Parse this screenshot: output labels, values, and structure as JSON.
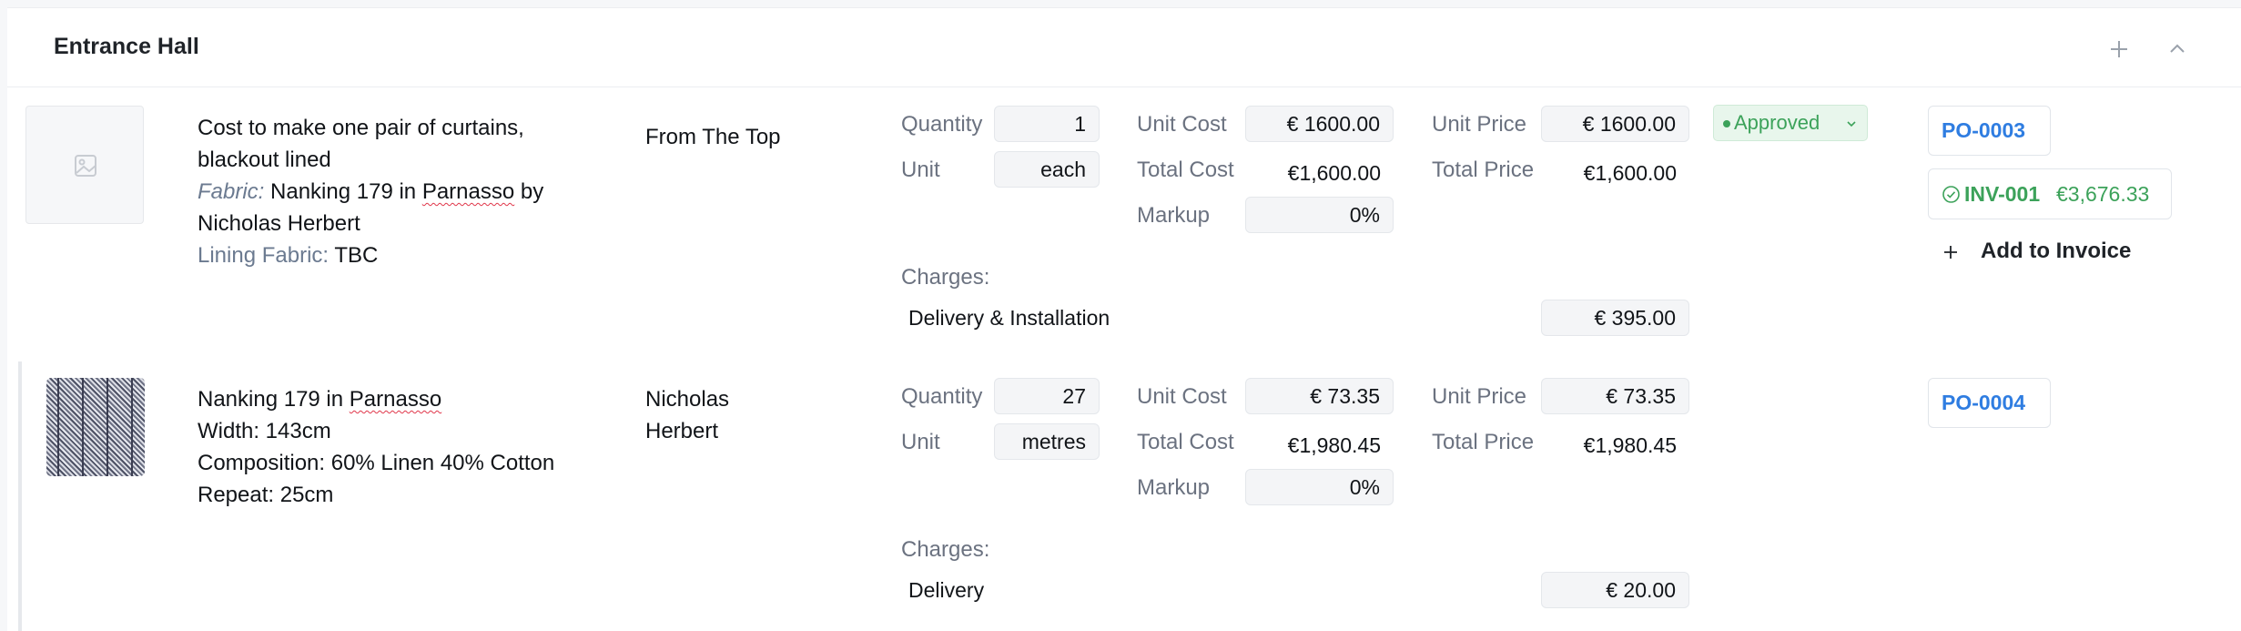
{
  "section": {
    "title": "Entrance Hall"
  },
  "labels": {
    "quantity": "Quantity",
    "unit": "Unit",
    "unit_cost": "Unit Cost",
    "total_cost": "Total Cost",
    "markup": "Markup",
    "unit_price": "Unit Price",
    "total_price": "Total Price",
    "charges": "Charges:"
  },
  "items": [
    {
      "desc_line1": "Cost to make one pair of curtains,",
      "desc_line2": "blackout lined",
      "fabric_label": "Fabric:",
      "fabric_pre": "Nanking 179 in ",
      "fabric_link": "Parnasso",
      "fabric_post": " by",
      "fabric_line2": "Nicholas Herbert",
      "lining_label": "Lining Fabric:",
      "lining_value": "TBC",
      "supplier": "From The Top",
      "quantity": "1",
      "unit": "each",
      "unit_cost": "€ 1600.00",
      "total_cost": "€1,600.00",
      "markup": "0%",
      "unit_price": "€ 1600.00",
      "total_price": "€1,600.00",
      "status": "Approved",
      "po": "PO-0003",
      "invoice": {
        "number": "INV-001",
        "amount": "€3,676.33"
      },
      "add_invoice": "Add to Invoice",
      "charge_name": "Delivery & Installation",
      "charge_amount": "€ 395.00"
    },
    {
      "desc_pre": "Nanking 179 in ",
      "desc_link": "Parnasso",
      "width": "Width: 143cm",
      "composition": "Composition: 60% Linen 40% Cotton",
      "repeat": "Repeat: 25cm",
      "supplier_line1": "Nicholas",
      "supplier_line2": "Herbert",
      "quantity": "27",
      "unit": "metres",
      "unit_cost": "€ 73.35",
      "total_cost": "€1,980.45",
      "markup": "0%",
      "unit_price": "€ 73.35",
      "total_price": "€1,980.45",
      "po": "PO-0004",
      "charge_name": "Delivery",
      "charge_amount": "€ 20.00"
    }
  ],
  "icons": {
    "add": "plus-icon",
    "collapse": "chevron-up-icon",
    "image_placeholder": "image-icon",
    "status_dot": "status-dot-icon",
    "status_chevron": "chevron-down-icon",
    "invoice_check": "check-circle-icon"
  },
  "colors": {
    "approved_green": "#3ca25a",
    "po_blue": "#2f7de1",
    "spell_red": "#e0364a"
  }
}
